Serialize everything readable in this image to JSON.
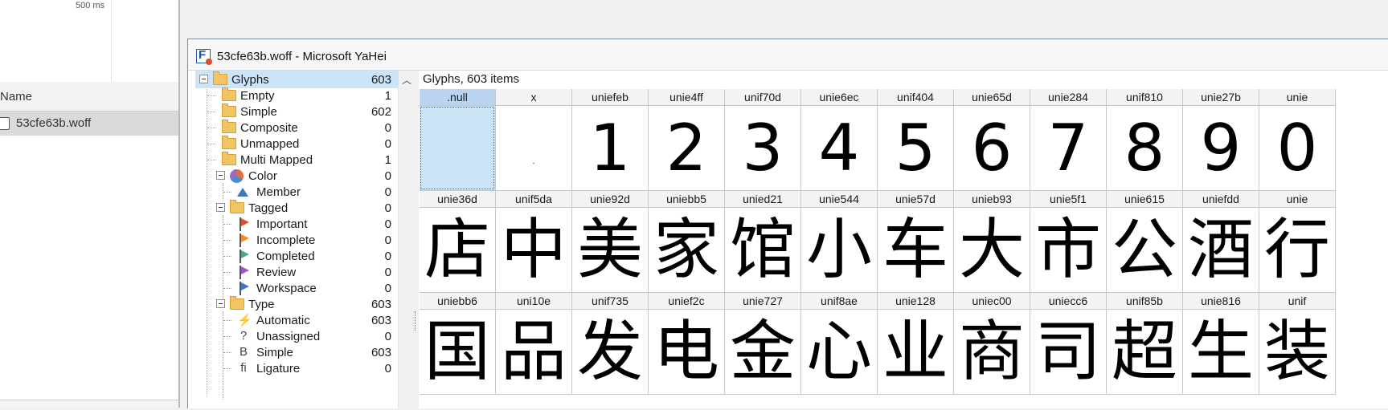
{
  "devtools": {
    "timeline_label": "500 ms",
    "column_header": "Name",
    "request_name": "53cfe63b.woff"
  },
  "window": {
    "title": "53cfe63b.woff - Microsoft YaHei"
  },
  "tree": {
    "glyphs": {
      "label": "Glyphs",
      "count": "603"
    },
    "items": [
      {
        "label": "Empty",
        "count": "1"
      },
      {
        "label": "Simple",
        "count": "602"
      },
      {
        "label": "Composite",
        "count": "0"
      },
      {
        "label": "Unmapped",
        "count": "0"
      },
      {
        "label": "Multi Mapped",
        "count": "1"
      }
    ],
    "color": {
      "label": "Color",
      "count": "0"
    },
    "member": {
      "label": "Member",
      "count": "0"
    },
    "tagged": {
      "label": "Tagged",
      "count": "0"
    },
    "tags": [
      {
        "label": "Important",
        "count": "0",
        "color": "#e04b2b"
      },
      {
        "label": "Incomplete",
        "count": "0",
        "color": "#f08a2a"
      },
      {
        "label": "Completed",
        "count": "0",
        "color": "#4aa58c"
      },
      {
        "label": "Review",
        "count": "0",
        "color": "#9b59c6"
      },
      {
        "label": "Workspace",
        "count": "0",
        "color": "#3b78c0"
      }
    ],
    "type": {
      "label": "Type",
      "count": "603"
    },
    "types": [
      {
        "label": "Automatic",
        "count": "603",
        "icon": "⚡"
      },
      {
        "label": "Unassigned",
        "count": "0",
        "icon": "?"
      },
      {
        "label": "Simple",
        "count": "603",
        "icon": "B"
      },
      {
        "label": "Ligature",
        "count": "0",
        "icon": "fi"
      }
    ]
  },
  "grid": {
    "title": "Glyphs, 603 items",
    "rows": [
      [
        {
          "name": ".null",
          "glyph": "",
          "selected": true
        },
        {
          "name": "x",
          "glyph": ""
        },
        {
          "name": "uniefeb",
          "glyph": "1"
        },
        {
          "name": "unie4ff",
          "glyph": "2"
        },
        {
          "name": "unif70d",
          "glyph": "3"
        },
        {
          "name": "unie6ec",
          "glyph": "4"
        },
        {
          "name": "unif404",
          "glyph": "5"
        },
        {
          "name": "unie65d",
          "glyph": "6"
        },
        {
          "name": "unie284",
          "glyph": "7"
        },
        {
          "name": "unif810",
          "glyph": "8"
        },
        {
          "name": "unie27b",
          "glyph": "9"
        },
        {
          "name": "unie",
          "glyph": "0"
        }
      ],
      [
        {
          "name": "unie36d",
          "glyph": "店"
        },
        {
          "name": "unif5da",
          "glyph": "中"
        },
        {
          "name": "unie92d",
          "glyph": "美"
        },
        {
          "name": "uniebb5",
          "glyph": "家"
        },
        {
          "name": "unied21",
          "glyph": "馆"
        },
        {
          "name": "unie544",
          "glyph": "小"
        },
        {
          "name": "unie57d",
          "glyph": "车"
        },
        {
          "name": "unieb93",
          "glyph": "大"
        },
        {
          "name": "unie5f1",
          "glyph": "市"
        },
        {
          "name": "unie615",
          "glyph": "公"
        },
        {
          "name": "uniefdd",
          "glyph": "酒"
        },
        {
          "name": "unie",
          "glyph": "行"
        }
      ],
      [
        {
          "name": "uniebb6",
          "glyph": "国"
        },
        {
          "name": "uni10e",
          "glyph": "品"
        },
        {
          "name": "unif735",
          "glyph": "发"
        },
        {
          "name": "unief2c",
          "glyph": "电"
        },
        {
          "name": "unie727",
          "glyph": "金"
        },
        {
          "name": "unif8ae",
          "glyph": "心"
        },
        {
          "name": "unie128",
          "glyph": "业"
        },
        {
          "name": "uniec00",
          "glyph": "商"
        },
        {
          "name": "uniecc6",
          "glyph": "司"
        },
        {
          "name": "unif85b",
          "glyph": "超"
        },
        {
          "name": "unie816",
          "glyph": "生"
        },
        {
          "name": "unif",
          "glyph": "装"
        }
      ]
    ]
  }
}
